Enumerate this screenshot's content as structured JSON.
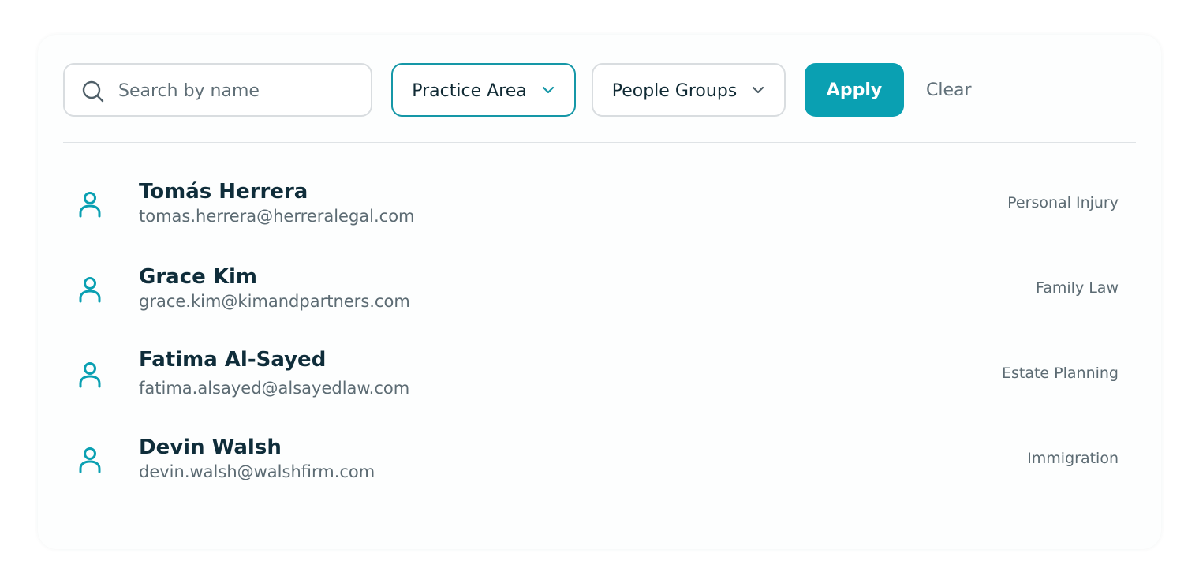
{
  "filters": {
    "search_placeholder": "Search by name",
    "search_value": "",
    "practice_area_label": "Practice Area",
    "people_groups_label": "People Groups",
    "apply_label": "Apply",
    "clear_label": "Clear"
  },
  "people": [
    {
      "name": "Tomás Herrera",
      "email": "tomas.herrera@herreralegal.com",
      "practice_area": "Personal Injury"
    },
    {
      "name": "Grace Kim",
      "email": "grace.kim@kimandpartners.com",
      "practice_area": "Family Law"
    },
    {
      "name": "Fatima Al-Sayed",
      "email": "fatima.alsayed@alsayedlaw.com",
      "practice_area": "Estate Planning"
    },
    {
      "name": "Devin Walsh",
      "email": "devin.walsh@walshfirm.com",
      "practice_area": "Immigration"
    }
  ],
  "icons": {
    "search": "search-icon",
    "chevron": "chevron-down-icon",
    "person": "person-icon"
  },
  "colors": {
    "accent": "#0aa0b2",
    "accent_border": "#1597a7",
    "title_text": "#0f2d3a",
    "muted_text": "#5c6b73"
  }
}
